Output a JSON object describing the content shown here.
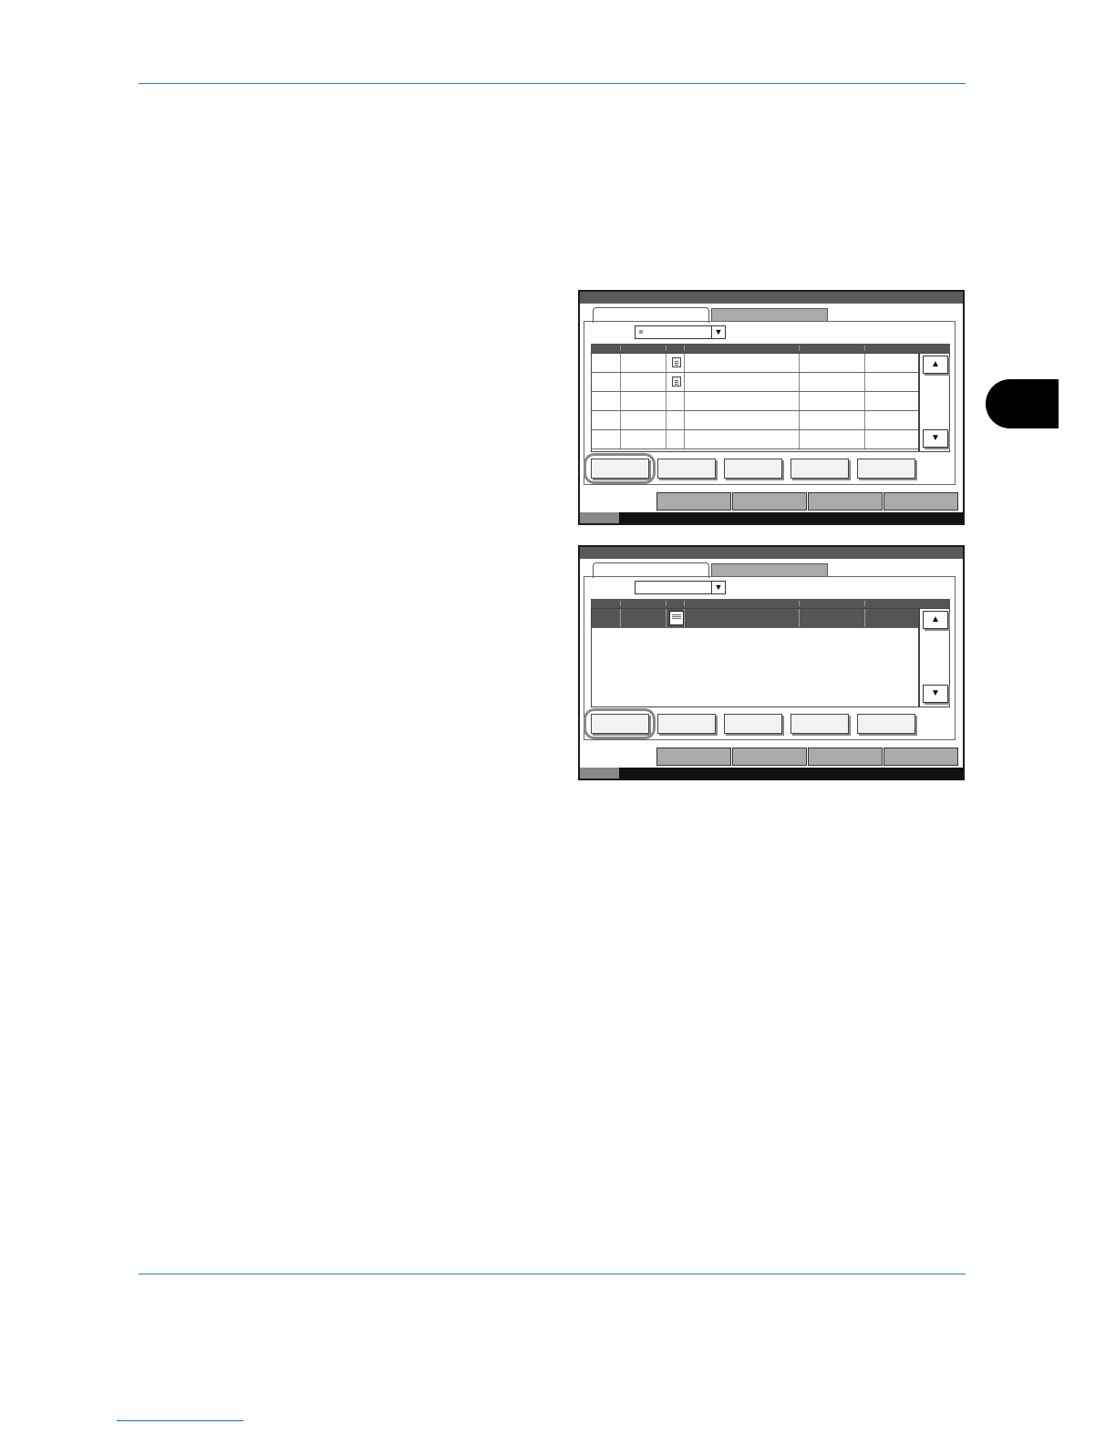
{
  "page": {
    "header_rule": "",
    "footer_link": ""
  },
  "panels": [
    {
      "id": "panel-1",
      "dropdown_value": "",
      "rows": [
        {
          "selected": false,
          "has_icon": true
        },
        {
          "selected": false,
          "has_icon": true
        },
        {
          "selected": false,
          "has_icon": false
        },
        {
          "selected": false,
          "has_icon": false
        },
        {
          "selected": false,
          "has_icon": false
        }
      ],
      "highlighted_button": 1
    },
    {
      "id": "panel-2",
      "dropdown_value": "",
      "rows": [
        {
          "selected": true,
          "has_icon": true
        }
      ],
      "highlighted_button": 1
    }
  ],
  "icons": {
    "scroll_up": "▲",
    "scroll_down": "▼",
    "dropdown": "▼"
  },
  "colors": {
    "rule": "#1f7fc0",
    "chapter_tab": "#000000",
    "panel_titlebar": "#5a5a5a",
    "selected_row": "#555555"
  }
}
